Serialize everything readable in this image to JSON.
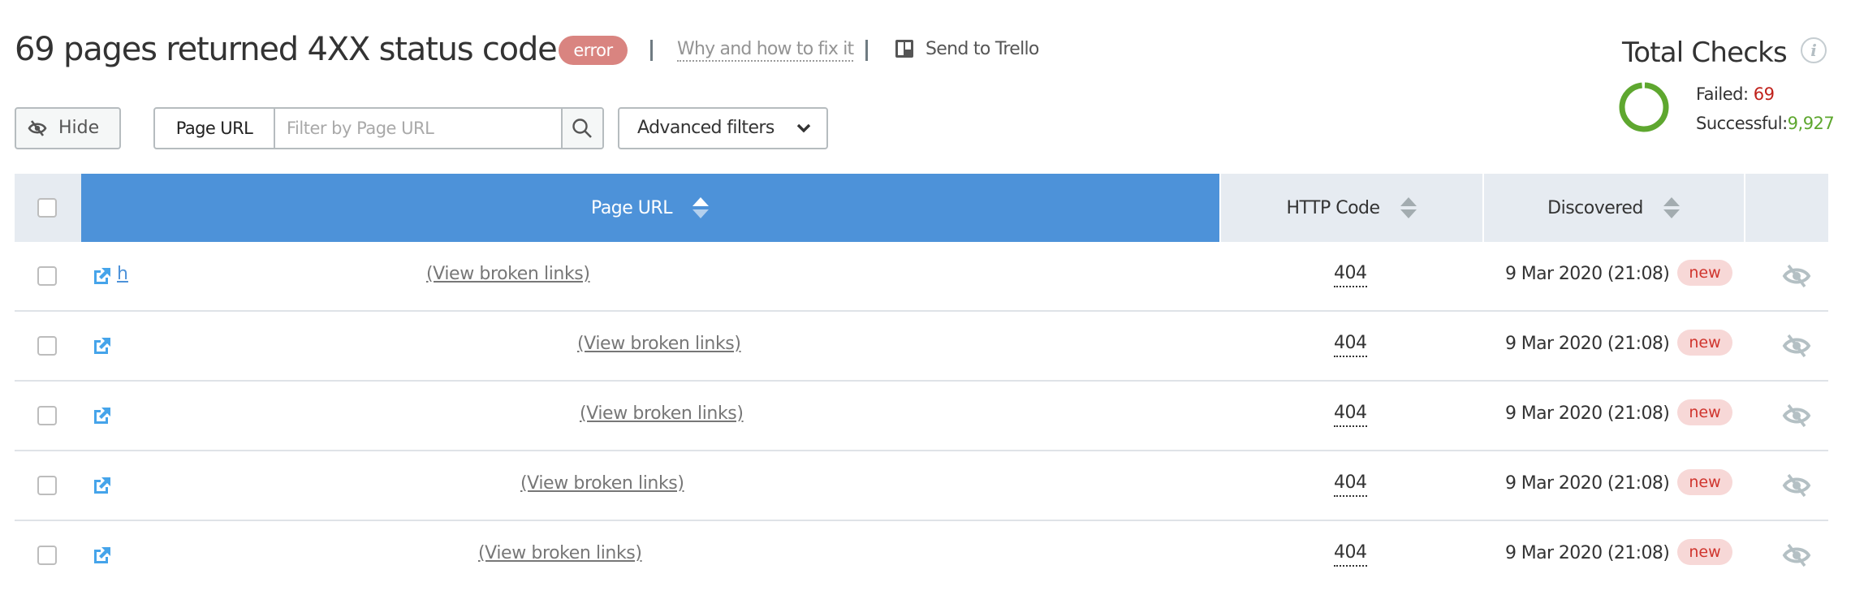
{
  "header": {
    "title": "69 pages returned 4XX status code",
    "severity_badge": "error",
    "fix_link": "Why and how to fix it",
    "send_to_trello": "Send to Trello"
  },
  "total_checks": {
    "title": "Total Checks",
    "info_icon": "i",
    "failed_label": "Failed:",
    "failed_value": "69",
    "successful_label": "Successful:",
    "successful_value": "9,927",
    "failed_count": 69,
    "successful_count": 9927,
    "colors": {
      "failed": "#c0221c",
      "successful": "#5ea72f"
    }
  },
  "toolbar": {
    "hide_label": "Hide",
    "filter_field_label": "Page URL",
    "filter_placeholder": "Filter by Page URL",
    "filter_value": "",
    "advanced_filters_label": "Advanced filters"
  },
  "table": {
    "columns": [
      {
        "key": "page_url",
        "label": "Page URL",
        "sorted": "asc"
      },
      {
        "key": "http_code",
        "label": "HTTP Code",
        "sorted": null
      },
      {
        "key": "discovered",
        "label": "Discovered",
        "sorted": null
      }
    ],
    "rows": [
      {
        "url_visible": "h",
        "view_broken_links": "(View broken links)",
        "http_code": "404",
        "discovered": "9 Mar 2020 (21:08)",
        "badge": "new"
      },
      {
        "url_visible": "",
        "view_broken_links": "(View broken links)",
        "http_code": "404",
        "discovered": "9 Mar 2020 (21:08)",
        "badge": "new"
      },
      {
        "url_visible": "",
        "view_broken_links": "(View broken links)",
        "http_code": "404",
        "discovered": "9 Mar 2020 (21:08)",
        "badge": "new"
      },
      {
        "url_visible": "",
        "view_broken_links": "(View broken links)",
        "http_code": "404",
        "discovered": "9 Mar 2020 (21:08)",
        "badge": "new"
      },
      {
        "url_visible": "",
        "view_broken_links": "(View broken links)",
        "http_code": "404",
        "discovered": "9 Mar 2020 (21:08)",
        "badge": "new"
      }
    ]
  },
  "colors": {
    "accent_header": "#4d92d9",
    "error_badge": "#d98480",
    "new_badge_bg": "#f7d8d7",
    "new_badge_text": "#d0352e",
    "link_icon": "#45a4ea"
  }
}
